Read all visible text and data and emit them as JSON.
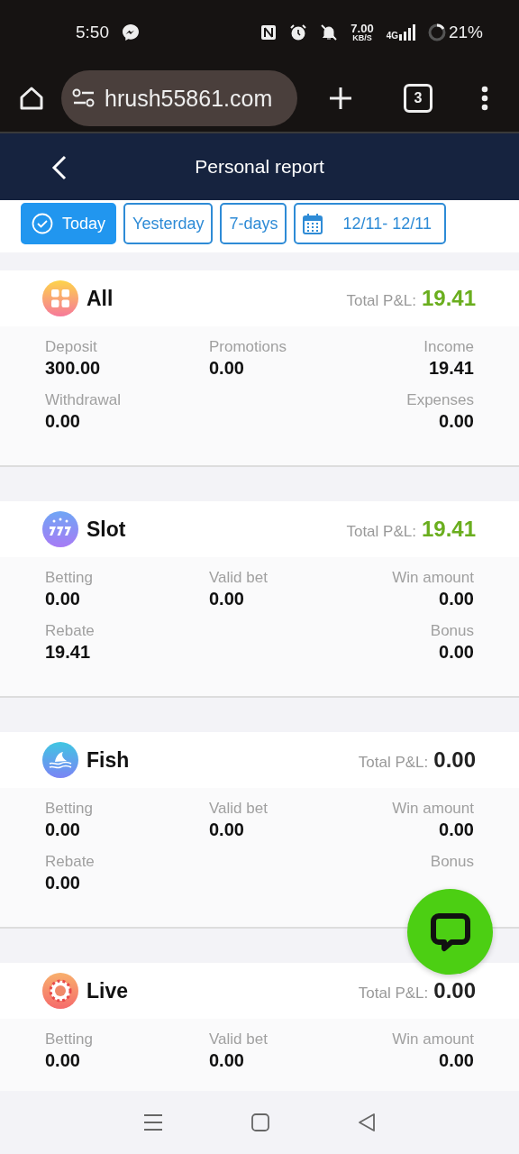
{
  "status_bar": {
    "time": "5:50",
    "speed": "7.00",
    "speed_unit": "KB/S",
    "network": "4G",
    "battery": "21%"
  },
  "browser": {
    "url": "hrush55861.com",
    "tab_count": "3"
  },
  "header": {
    "title": "Personal report"
  },
  "filters": [
    {
      "label": "Today",
      "selected": true
    },
    {
      "label": "Yesterday",
      "selected": false
    },
    {
      "label": "7-days",
      "selected": false
    }
  ],
  "date_range": {
    "label": "12/11- 12/11"
  },
  "cards": [
    {
      "kind": "all",
      "title": "All",
      "total": {
        "label": "Total P&L:",
        "value": "19.41",
        "color": "#6aae1e"
      },
      "rows": [
        {
          "left": {
            "label": "Deposit",
            "value": "300.00"
          },
          "middle": {
            "label": "Promotions",
            "value": "0.00"
          },
          "right": {
            "label": "Income",
            "value": "19.41"
          }
        },
        {
          "left": {
            "label": "Withdrawal",
            "value": "0.00"
          },
          "right": {
            "label": "Expenses",
            "value": "0.00"
          }
        }
      ]
    },
    {
      "kind": "slot",
      "title": "Slot",
      "total": {
        "label": "Total P&L:",
        "value": "19.41",
        "color": "#6aae1e"
      },
      "rows": [
        {
          "left": {
            "label": "Betting",
            "value": "0.00"
          },
          "middle": {
            "label": "Valid bet",
            "value": "0.00"
          },
          "right": {
            "label": "Win amount",
            "value": "0.00"
          }
        },
        {
          "left": {
            "label": "Rebate",
            "value": "19.41"
          },
          "right": {
            "label": "Bonus",
            "value": "0.00"
          }
        }
      ]
    },
    {
      "kind": "fish",
      "title": "Fish",
      "total": {
        "label": "Total P&L:",
        "value": "0.00",
        "color": "#222222"
      },
      "rows": [
        {
          "left": {
            "label": "Betting",
            "value": "0.00"
          },
          "middle": {
            "label": "Valid bet",
            "value": "0.00"
          },
          "right": {
            "label": "Win amount",
            "value": "0.00"
          }
        },
        {
          "left": {
            "label": "Rebate",
            "value": "0.00"
          },
          "right": {
            "label": "Bonus"
          }
        }
      ]
    },
    {
      "kind": "live",
      "title": "Live",
      "total": {
        "label": "Total P&L:",
        "value": "0.00",
        "color": "#222222"
      },
      "rows": [
        {
          "left": {
            "label": "Betting",
            "value": "0.00"
          },
          "middle": {
            "label": "Valid bet",
            "value": "0.00"
          },
          "right": {
            "label": "Win amount",
            "value": "0.00"
          }
        }
      ]
    }
  ]
}
